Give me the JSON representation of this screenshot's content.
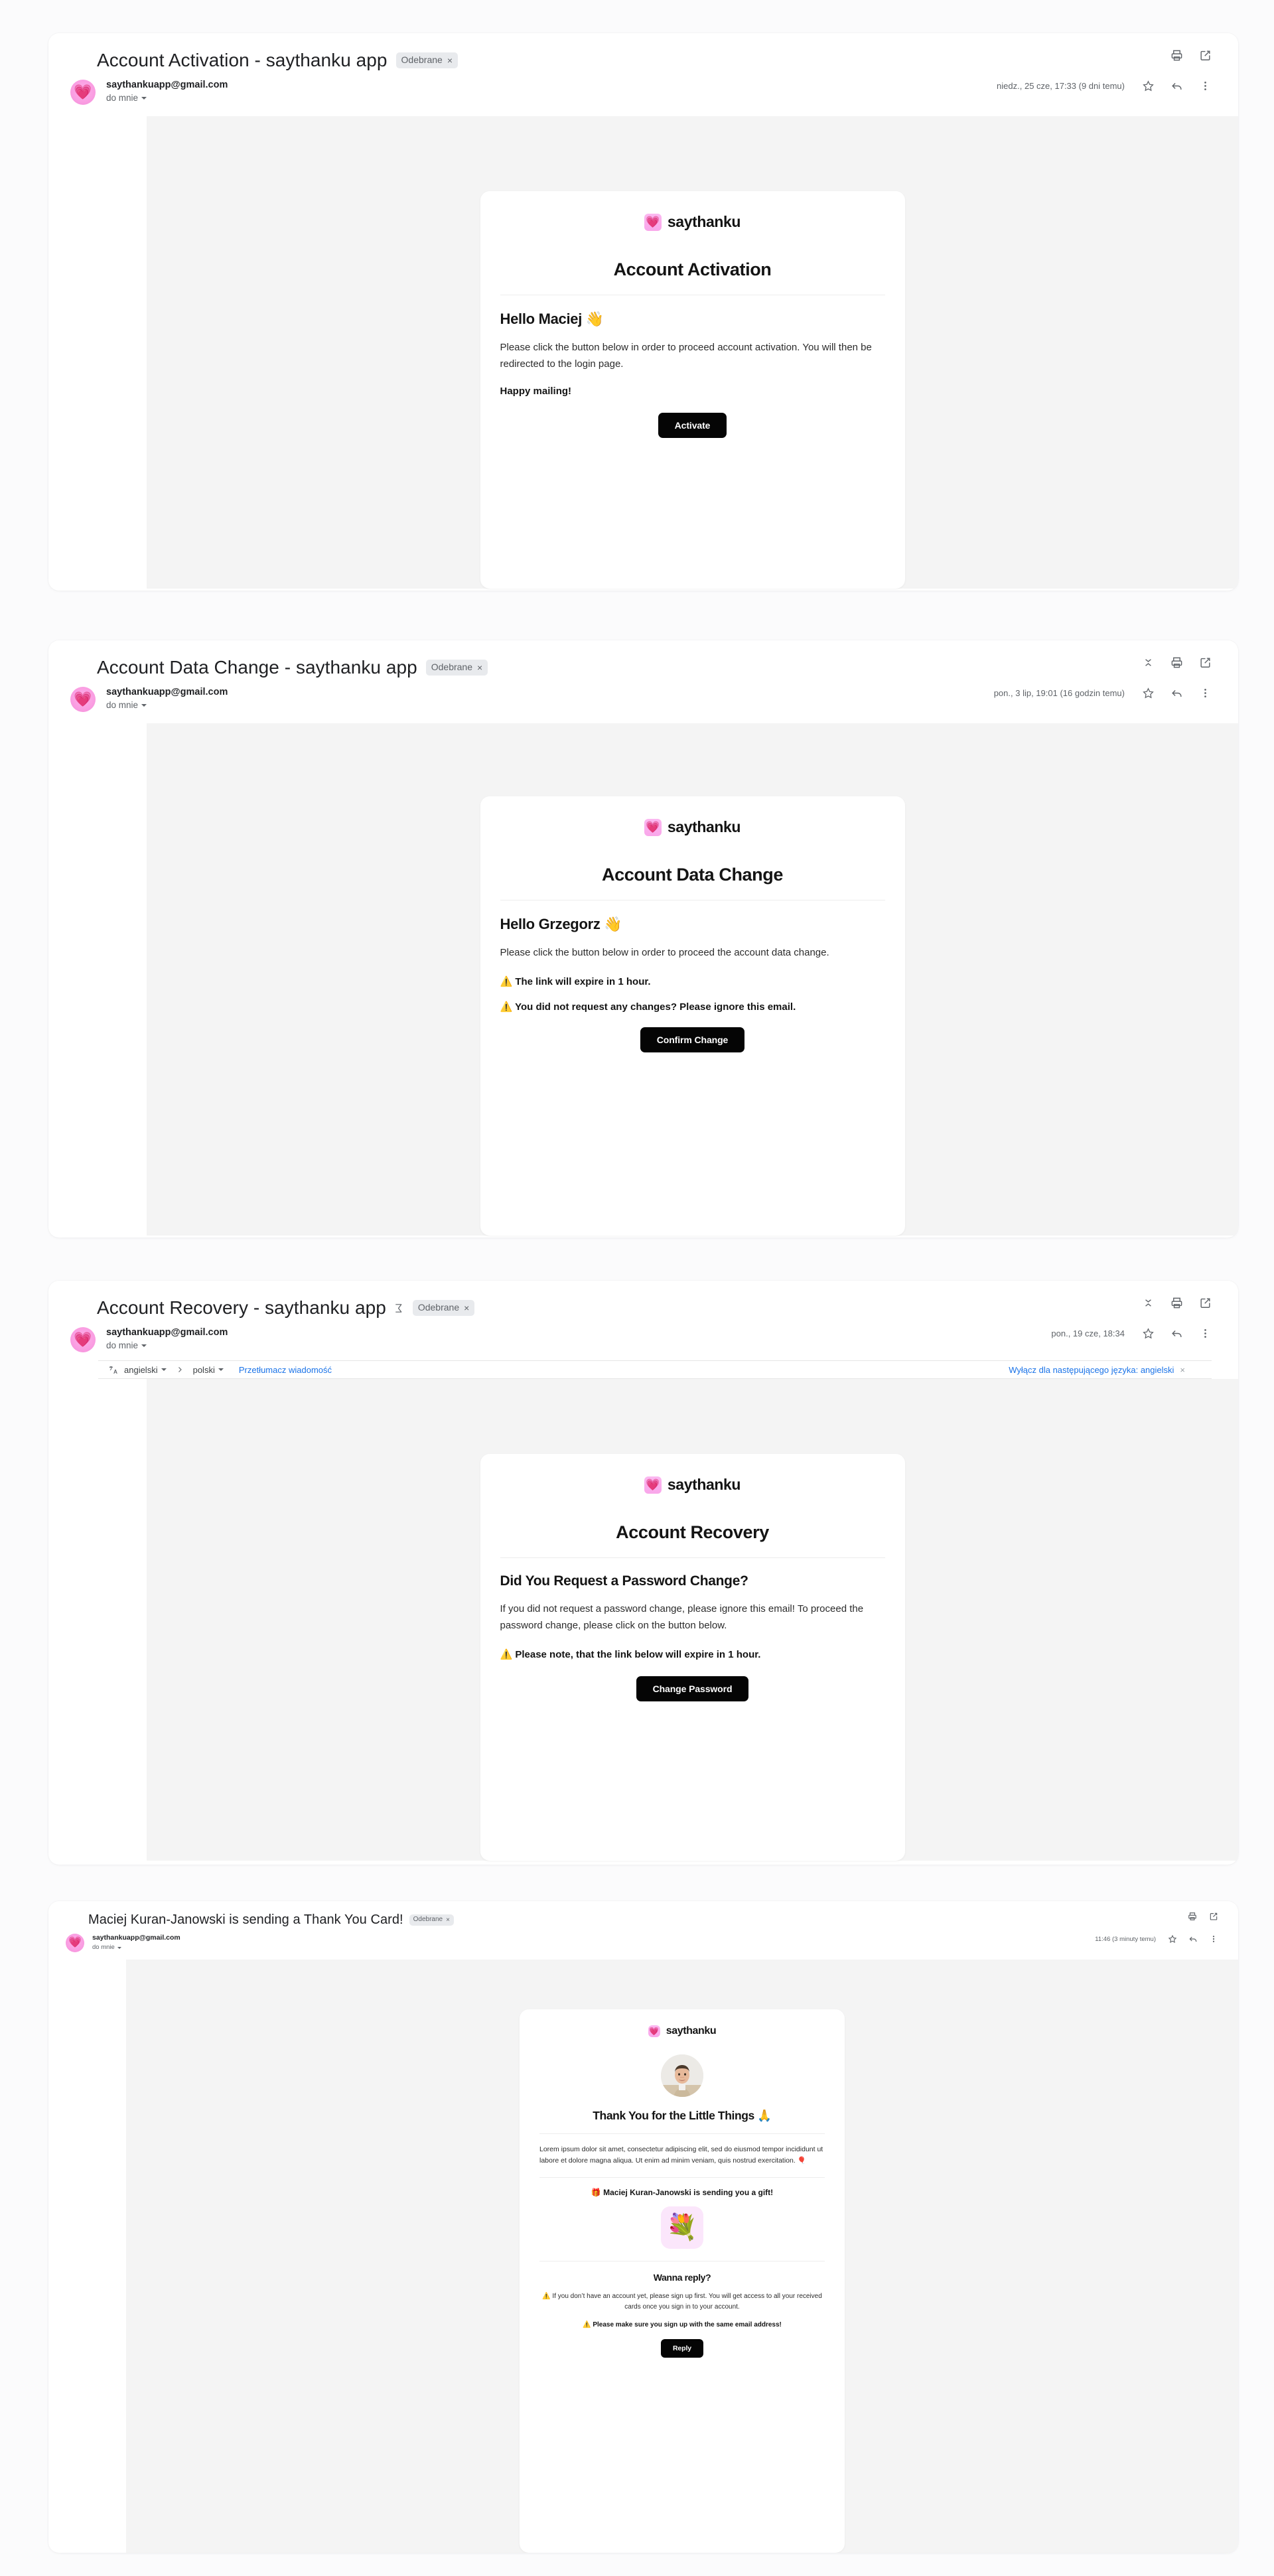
{
  "app": {
    "brand_name": "saythanku",
    "brand_icon": "pink-heart-emoji"
  },
  "common": {
    "sender_email": "saythankuapp@gmail.com",
    "to_label": "do mnie",
    "label_chip": "Odebrane",
    "label_chip_close": "×",
    "print_icon": "print-icon",
    "popout_icon": "open-in-new-icon",
    "star_icon": "star-icon",
    "reply_icon": "reply-icon",
    "more_icon": "more-vert-icon",
    "collapse_icon": "collapse-all-icon"
  },
  "emails": [
    {
      "id": "account-activation",
      "subject": "Account Activation - saythanku app",
      "has_sigma_icon": false,
      "has_collapse_icon": false,
      "date": "niedz., 25 cze, 17:33 (9 dni temu)",
      "card": {
        "title": "Account Activation",
        "greeting": "Hello Maciej 👋",
        "paragraph": "Please click the button below in order to proceed account activation. You will then be redirected to the login page.",
        "closing": "Happy mailing!",
        "cta": "Activate"
      }
    },
    {
      "id": "account-data-change",
      "subject": "Account Data Change - saythanku app",
      "has_sigma_icon": false,
      "has_collapse_icon": true,
      "date": "pon., 3 lip, 19:01 (16 godzin temu)",
      "card": {
        "title": "Account Data Change",
        "greeting": "Hello Grzegorz 👋",
        "paragraph": "Please click the button below in order to proceed the account data change.",
        "warning_1": "⚠️ The link will expire in 1 hour.",
        "warning_2": "⚠️ You did not request any changes? Please ignore this email.",
        "cta": "Confirm Change"
      }
    },
    {
      "id": "account-recovery",
      "subject": "Account Recovery - saythanku app",
      "has_sigma_icon": true,
      "has_collapse_icon": true,
      "date": "pon., 19 cze, 18:34",
      "translate": {
        "source_lang": "angielski",
        "target_lang": "polski",
        "translate_link": "Przetłumacz wiadomość",
        "disable_link": "Wyłącz dla następującego języka: angielski",
        "close": "×",
        "icon": "translate-icon",
        "arrow": "›"
      },
      "card": {
        "title": "Account Recovery",
        "greeting": "Did You Request a Password Change?",
        "paragraph": "If you did not request a password change, please ignore this email! To proceed the password change, please click on the button below.",
        "warning_1": "⚠️ Please note, that the link below will expire in 1 hour.",
        "cta": "Change Password"
      }
    },
    {
      "id": "thank-you-card",
      "subject": "Maciej Kuran-Janowski is sending a Thank You Card!",
      "has_sigma_icon": false,
      "has_collapse_icon": false,
      "date": "11:46 (3 minuty temu)",
      "card": {
        "photo_alt": "sender-photo",
        "title": "Thank You for the Little Things 🙏",
        "paragraph": "Lorem ipsum dolor sit amet, consectetur adipiscing elit, sed do eiusmod tempor incididunt ut labore et dolore magna aliqua. Ut enim ad minim veniam, quis nostrud exercitation. 🎈",
        "gift_line": "🎁 Maciej Kuran-Janowski is sending you a gift!",
        "gift_emoji": "💐",
        "reply_title": "Wanna reply?",
        "note_1": "⚠️ If you don’t have an account yet, please sign up first. You will get access to all your received cards once you sign in to your account.",
        "note_2": "⚠️ Please make sure you sign up with the same email address!",
        "cta": "Reply"
      }
    }
  ],
  "colors": {
    "accent_pink": "#f9a6ea",
    "cta_black": "#050505",
    "link_blue": "#1a73e8",
    "body_grey": "#f4f4f4",
    "chip_grey": "#e8eaed"
  }
}
